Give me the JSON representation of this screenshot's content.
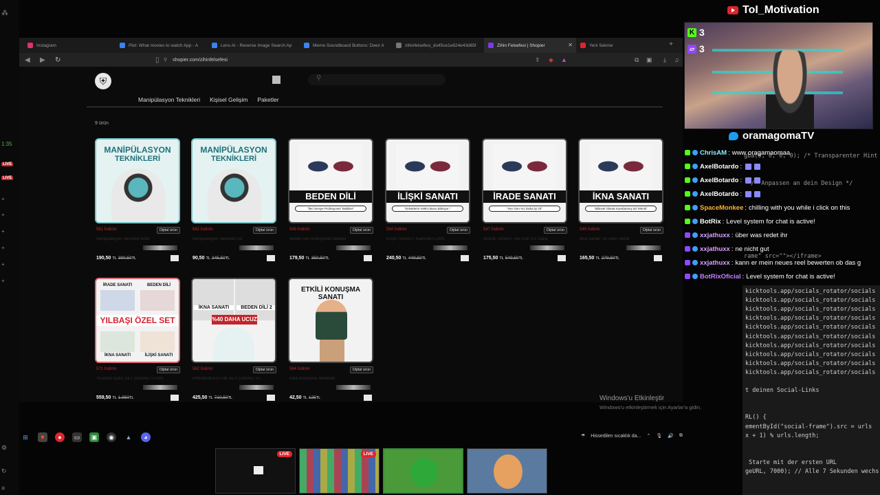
{
  "browser": {
    "tabs": [
      {
        "label": "Instagram",
        "color": "#e1306c"
      },
      {
        "label": "Plot: What movies to watch App - A",
        "color": "#3b82f6"
      },
      {
        "label": "Lens AI - Reverse Image Search Ap",
        "color": "#3b82f6"
      },
      {
        "label": "Meme Soundboard Buttons: Deez A",
        "color": "#3b82f6"
      },
      {
        "label": "zihinfelsefesi_do45ce1e824e43d65f",
        "color": "#777777"
      },
      {
        "label": "Zihin Felsefesi | Shopier",
        "color": "#7c3aed",
        "active": true
      },
      {
        "label": "Yeni Sekme",
        "color": "#e0242c"
      }
    ],
    "url": "shopier.com/zihinfelsefesi"
  },
  "shop": {
    "nav": [
      "Manipülasyon Teknikleri",
      "Kişisel Gelişim",
      "Paketler"
    ],
    "count": "9 ürün",
    "digital_label": "Dijital ürün",
    "products": [
      {
        "title_line1": "MANİPÜLASYON",
        "title_line2": "TEKNİKLERİ",
        "sold": "561 İndirim",
        "name": "Manipülasyon Teknikleri Kitle",
        "price": "190,50",
        "old": "390,50",
        "currency": "TL",
        "style": "blue"
      },
      {
        "title_line1": "MANİPÜLASYON",
        "title_line2": "TEKNİKLERİ",
        "sold": "542 İndirim",
        "name": "Manipülasyon Teknikleri Dil",
        "price": "90,50",
        "old": "245,50",
        "currency": "TL",
        "style": "blue"
      },
      {
        "banner": "BEDEN DİLİ",
        "subtitle": "\"İleri Seviye Profesyonel Taktikler\"",
        "sold": "549 İndirim",
        "name": "Beden Dili Profesyonel taktikler",
        "price": "179,50",
        "old": "350,50",
        "currency": "TL",
        "style": "plain"
      },
      {
        "banner": "İLİŞKİ SANATI",
        "subtitle": "\"Erkeklerin %99'u Bunu Bilmiyor.\"",
        "sold": "554 İndirim",
        "name": "İLİŞKİ SANATI: Kadınların Zihni",
        "price": "240,50",
        "old": "449,50",
        "currency": "TL",
        "style": "plain"
      },
      {
        "banner": "İRADE SANATI",
        "subtitle": "\"Her Gün %1 Daha İyi Ol\"",
        "sold": "547 İndirim",
        "name": "İRADE SANATI: Her Gün %1 Daha",
        "price": "175,50",
        "old": "549,50",
        "currency": "TL",
        "style": "plain"
      },
      {
        "banner": "İKNA SANATI",
        "subtitle": "\"Bilinsel Olarak Kanıtlanmış 50 Teknik\"",
        "sold": "549 İndirim",
        "name": "İkna Sanatı: 50 Adet Teknik",
        "price": "165,50",
        "old": "279,50",
        "currency": "TL",
        "style": "plain"
      },
      {
        "top1": "İRADE SANATI",
        "top2": "BEDEN DİLİ",
        "banner": "YILBAŞI ÖZEL SET",
        "bottom1": "İKNA SANATI",
        "bottom2": "İLİŞKİ SANATI",
        "sold": "571 İndirim",
        "name": "YILBAŞI ÖZEL SET (SINIRLI STOK)",
        "price": "559,50",
        "old": "1.950",
        "currency": "TL",
        "style": "red"
      },
      {
        "top1": "İKNA SANATI",
        "top2": "BEDEN DİLİ 2",
        "promo": "%40 DAHA UCUZ",
        "sold": "562 İndirim",
        "name": "PREMİUM EĞİTİM SETİ (SINIRLI STOK)",
        "price": "425,50",
        "old": "710,50",
        "currency": "TL",
        "style": "plain"
      },
      {
        "title_line1": "ETKİLİ KONUŞMA SANATI",
        "sold": "564 İndirim",
        "name": "Etkili Konuşma Teknikleri",
        "price": "42,50",
        "old": "125",
        "currency": "TL",
        "style": "plain"
      }
    ]
  },
  "windows": {
    "activate_title": "Windows'u Etkinleştir",
    "activate_sub": "Windows'u etkinleştirmek için Ayarlar'a gidin.",
    "tray_weather": "Hissedilen sıcaklık da...",
    "live": "LIVE"
  },
  "stream": {
    "title": "ToI_Motivation",
    "kick_count": "3",
    "twitch_count": "3",
    "twitter_name": "oramagomaTV"
  },
  "chat": [
    {
      "user": "ChrisAM",
      "text": "www oragamaomaa",
      "color": "#8ef0ff",
      "badge": "#53fc18"
    },
    {
      "user": "AxelBotardo",
      "text": "",
      "emotes": 2,
      "color": "#ffffff",
      "badge": "#53fc18"
    },
    {
      "user": "AxelBotardo",
      "text": "",
      "emotes": 2,
      "color": "#ffffff",
      "badge": "#53fc18"
    },
    {
      "user": "AxelBotardo",
      "text": "",
      "emotes": 2,
      "color": "#ffffff",
      "badge": "#53fc18"
    },
    {
      "user": "SpaceMonkee",
      "text": "chilling with you while i click on this",
      "color": "#ffb13a",
      "badge": "#53fc18"
    },
    {
      "user": "BotRix",
      "text": "Level system for chat is active!",
      "color": "#ffffff",
      "badge": "#53fc18"
    },
    {
      "user": "xxjathuxx",
      "text": "über was redet ihr",
      "color": "#d8a0ff",
      "badge": "#9146ff"
    },
    {
      "user": "xxjathuxx",
      "text": "ne nicht gut",
      "color": "#d8a0ff",
      "badge": "#9146ff"
    },
    {
      "user": "xxjathuxx",
      "text": "kann er mein neues reel bewerten ob das g",
      "color": "#d8a0ff",
      "badge": "#9146ff"
    },
    {
      "user": "BotRixOficial",
      "text": "Level system for chat is active!",
      "color": "#c080ff",
      "badge": "#9146ff"
    }
  ],
  "code_behind": [
    "gba(0, 0, 0, 0); /* Transparenter Hint",
    "/* Anpassen an dein Design */",
    "rame\" src=\"\"></iframe>"
  ],
  "code": [
    "kicktools.app/socials_rotator/socials",
    "kicktools.app/socials_rotator/socials",
    "kicktools.app/socials_rotator/socials",
    "kicktools.app/socials_rotator/socials",
    "kicktools.app/socials_rotator/socials",
    "kicktools.app/socials_rotator/socials",
    "kicktools.app/socials_rotator/socials",
    "kicktools.app/socials_rotator/socials",
    "kicktools.app/socials_rotator/socials",
    "kicktools.app/socials_rotator/socials",
    "",
    "t deinen Social-Links",
    "",
    "",
    "RL() {",
    "ementById(\"social-frame\").src = urls",
    "x + 1) % urls.length;",
    "",
    "",
    " Starte mit der ersten URL",
    "geURL, 7000); // Alle 7 Sekunden wechs"
  ],
  "leftstrip": {
    "time": "1:35",
    "live": "LIVE"
  }
}
